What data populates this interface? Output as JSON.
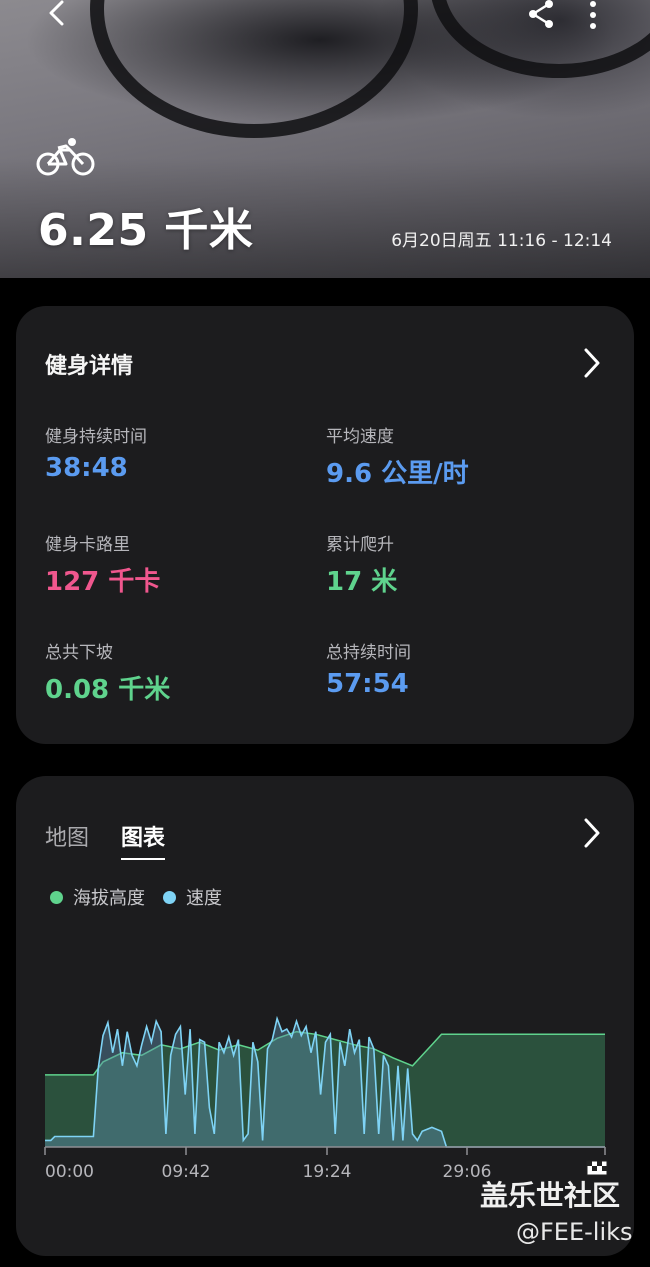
{
  "header": {
    "distance": "6.25 千米",
    "time_range": "6月20日周五 11:16 - 12:14",
    "icons": [
      "back-icon",
      "share-icon",
      "more-icon",
      "bicycle-icon"
    ]
  },
  "details": {
    "title": "健身详情",
    "stats": [
      {
        "label": "健身持续时间",
        "value": "38:48",
        "color": "#5b9bf0"
      },
      {
        "label": "平均速度",
        "value": "9.6 公里/时",
        "color": "#5b9bf0"
      },
      {
        "label": "健身卡路里",
        "value": "127 千卡",
        "color": "#f0578e"
      },
      {
        "label": "累计爬升",
        "value": "17 米",
        "color": "#5fd38d"
      },
      {
        "label": "总共下坡",
        "value": "0.08 千米",
        "color": "#5fd38d"
      },
      {
        "label": "总持续时间",
        "value": "57:54",
        "color": "#5b9bf0"
      }
    ]
  },
  "chart_card": {
    "tabs": [
      {
        "label": "地图",
        "active": false
      },
      {
        "label": "图表",
        "active": true
      }
    ],
    "legend": [
      {
        "label": "海拔高度",
        "color": "#5fd38d"
      },
      {
        "label": "速度",
        "color": "#7fd3f5"
      }
    ]
  },
  "chart_data": {
    "type": "area",
    "x_ticks": [
      "00:00",
      "09:42",
      "19:24",
      "29:06"
    ],
    "x_unit": "minutes",
    "x_range": [
      0,
      57.9
    ],
    "series": [
      {
        "name": "海拔高度",
        "color": "#5fd38d",
        "points": [
          [
            0,
            0.55
          ],
          [
            5,
            0.55
          ],
          [
            6,
            0.65
          ],
          [
            8,
            0.72
          ],
          [
            10,
            0.7
          ],
          [
            12,
            0.78
          ],
          [
            14,
            0.75
          ],
          [
            16,
            0.8
          ],
          [
            18,
            0.74
          ],
          [
            20,
            0.78
          ],
          [
            22,
            0.74
          ],
          [
            24,
            0.83
          ],
          [
            26,
            0.88
          ],
          [
            28,
            0.86
          ],
          [
            30,
            0.82
          ],
          [
            32,
            0.78
          ],
          [
            34,
            0.75
          ],
          [
            36,
            0.68
          ],
          [
            38,
            0.62
          ],
          [
            39,
            0.7
          ],
          [
            40,
            0.78
          ],
          [
            41,
            0.86
          ],
          [
            57.9,
            0.86
          ]
        ]
      },
      {
        "name": "速度",
        "color": "#7fd3f5",
        "points": [
          [
            0,
            0.05
          ],
          [
            0.6,
            0.05
          ],
          [
            1,
            0.08
          ],
          [
            5,
            0.08
          ],
          [
            5.5,
            0.6
          ],
          [
            6,
            0.85
          ],
          [
            6.5,
            0.95
          ],
          [
            7,
            0.72
          ],
          [
            7.5,
            0.9
          ],
          [
            8,
            0.62
          ],
          [
            8.5,
            0.88
          ],
          [
            9,
            0.7
          ],
          [
            9.5,
            0.62
          ],
          [
            10,
            0.78
          ],
          [
            10.5,
            0.92
          ],
          [
            11,
            0.8
          ],
          [
            11.5,
            0.96
          ],
          [
            12,
            0.88
          ],
          [
            12.5,
            0.1
          ],
          [
            13,
            0.7
          ],
          [
            13.5,
            0.86
          ],
          [
            14,
            0.92
          ],
          [
            14.5,
            0.4
          ],
          [
            15,
            0.9
          ],
          [
            15.5,
            0.1
          ],
          [
            16,
            0.82
          ],
          [
            16.5,
            0.8
          ],
          [
            17,
            0.3
          ],
          [
            17.5,
            0.1
          ],
          [
            18,
            0.8
          ],
          [
            18.5,
            0.72
          ],
          [
            19,
            0.84
          ],
          [
            19.5,
            0.7
          ],
          [
            20,
            0.82
          ],
          [
            20.5,
            0.05
          ],
          [
            21,
            0.1
          ],
          [
            21.5,
            0.8
          ],
          [
            22,
            0.65
          ],
          [
            22.5,
            0.05
          ],
          [
            23,
            0.75
          ],
          [
            23.5,
            0.82
          ],
          [
            24,
            0.98
          ],
          [
            24.5,
            0.88
          ],
          [
            25,
            0.9
          ],
          [
            25.5,
            0.84
          ],
          [
            26,
            0.96
          ],
          [
            26.5,
            0.85
          ],
          [
            27,
            0.92
          ],
          [
            27.5,
            0.72
          ],
          [
            28,
            0.88
          ],
          [
            28.5,
            0.4
          ],
          [
            29,
            0.8
          ],
          [
            29.5,
            0.86
          ],
          [
            30,
            0.1
          ],
          [
            30.5,
            0.8
          ],
          [
            31,
            0.62
          ],
          [
            31.5,
            0.9
          ],
          [
            32,
            0.72
          ],
          [
            32.5,
            0.82
          ],
          [
            33,
            0.1
          ],
          [
            33.5,
            0.84
          ],
          [
            34,
            0.75
          ],
          [
            34.5,
            0.1
          ],
          [
            35,
            0.7
          ],
          [
            35.5,
            0.62
          ],
          [
            36,
            0.05
          ],
          [
            36.5,
            0.62
          ],
          [
            37,
            0.05
          ],
          [
            37.5,
            0.6
          ],
          [
            38,
            0.1
          ],
          [
            38.5,
            0.05
          ],
          [
            39,
            0.12
          ],
          [
            40,
            0.15
          ],
          [
            41,
            0.12
          ],
          [
            41.5,
            0.0
          ],
          [
            57.9,
            0.0
          ]
        ]
      }
    ]
  },
  "watermark": {
    "title": "盖乐世社区",
    "user": "@FEE-liks"
  }
}
